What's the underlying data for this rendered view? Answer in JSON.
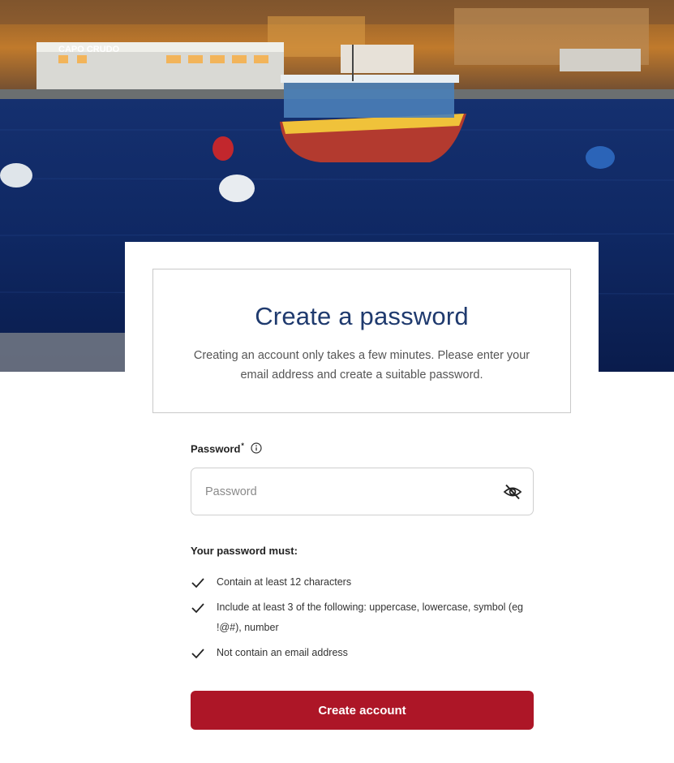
{
  "hero": {
    "sign_text": "CAPO CRUDO"
  },
  "colors": {
    "title": "#1f3a6e",
    "primary_button": "#ad1627",
    "text": "#333333",
    "border": "#c9c9c9"
  },
  "header": {
    "title": "Create a password",
    "subtitle": "Creating an account only takes a few minutes. Please enter your email address and create a suitable password."
  },
  "password_field": {
    "label": "Password",
    "required_marker": "*",
    "info_icon": "info-circle-icon",
    "placeholder": "Password",
    "value": "",
    "toggle_icon": "eye-off-icon"
  },
  "requirements": {
    "heading": "Your password must:",
    "icon": "check-icon",
    "items": [
      "Contain at least 12 characters",
      "Include at least 3 of the following: uppercase, lowercase, symbol (eg !@#), number",
      "Not contain an email address"
    ]
  },
  "submit": {
    "label": "Create account"
  }
}
